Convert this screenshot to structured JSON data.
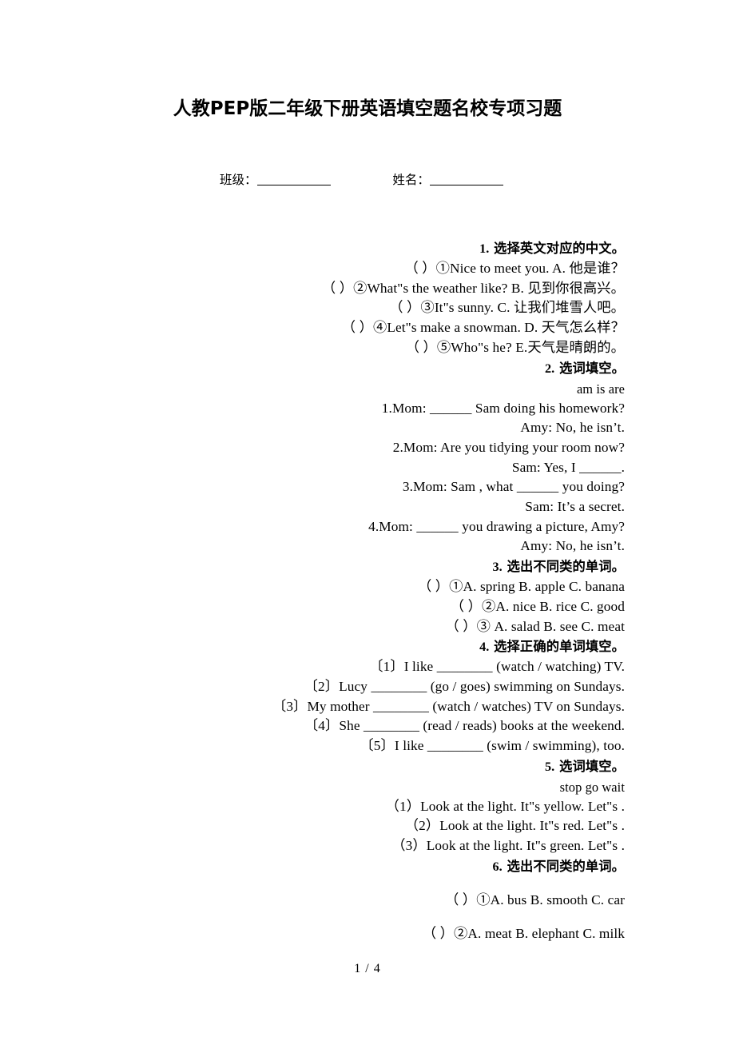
{
  "document": {
    "title": "人教PEP版二年级下册英语填空题名校专项习题",
    "page_footer": "1 / 4"
  },
  "header_fields": {
    "class_label": "班级：",
    "name_label": "姓名："
  },
  "sections": [
    {
      "number": "1.",
      "heading": "选择英文对应的中文。",
      "items": [
        "（    ）①Nice to meet you.            A. 他是谁？",
        "（    ）②What\"s the weather like?        B. 见到你很高兴。",
        "（    ）③It\"s sunny.               C. 让我们堆雪人吧。",
        "（    ）④Let\"s make a snowman.         D. 天气怎么样？",
        "（    ）⑤Who\"s he?                E.天气是晴朗的。"
      ]
    },
    {
      "number": "2.",
      "heading": "选词填空。",
      "wordbank": "am is are",
      "items": [
        "1.Mom: ______ Sam doing his homework?",
        "Amy: No, he isn’t.",
        "2.Mom: Are you tidying your room now?",
        "Sam: Yes, I ______.",
        "3.Mom: Sam , what ______ you doing?",
        "Sam: It’s a secret.",
        "4.Mom: ______ you drawing a picture, Amy?",
        "Amy: No, he isn’t."
      ]
    },
    {
      "number": "3.",
      "heading": "选出不同类的单词。",
      "items": [
        "（    ）①A. spring    B. apple     C. banana",
        "（    ）②A. nice      B. rice      C. good",
        "（    ）③ A. salad     B. see      C. meat"
      ]
    },
    {
      "number": "4.",
      "heading": "选择正确的单词填空。",
      "items": [
        "〔1〕I like ________ (watch / watching) TV.",
        "〔2〕Lucy ________ (go / goes) swimming on Sundays.",
        "〔3〕My mother ________ (watch / watches) TV on Sundays.",
        "〔4〕She ________ (read / reads) books at the weekend.",
        "〔5〕I like ________ (swim / swimming), too."
      ]
    },
    {
      "number": "5.",
      "heading": "选词填空。",
      "wordbank": "stop  go  wait",
      "items": [
        "（1）Look at the light. It\"s yellow. Let\"s    .",
        "（2）Look at the light. It\"s red. Let\"s    .",
        "（3）Look at the light. It\"s green. Let\"s    ."
      ]
    },
    {
      "number": "6.",
      "heading": "选出不同类的单词。",
      "items": [
        "（    ）①A. bus        B. smooth      C. car",
        "（    ）②A. meat       B. elephant    C. milk"
      ]
    }
  ]
}
